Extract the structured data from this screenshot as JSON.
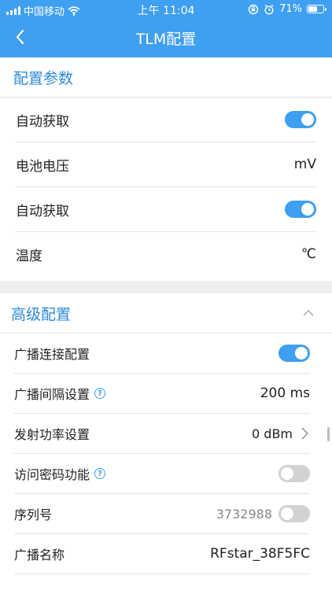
{
  "status_bar": {
    "carrier": "中国移动",
    "time": "上午 11:04",
    "battery": "71%",
    "battery_level": 0.71
  },
  "nav": {
    "title": "TLM配置"
  },
  "config": {
    "header": "配置参数",
    "rows": [
      {
        "label": "自动获取",
        "type": "toggle",
        "on": true
      },
      {
        "label": "电池电压",
        "value": "mV"
      },
      {
        "label": "自动获取",
        "type": "toggle",
        "on": true
      },
      {
        "label": "温度",
        "value": "℃"
      }
    ]
  },
  "advanced": {
    "header": "高级配置",
    "rows": [
      {
        "label": "广播连接配置",
        "type": "toggle",
        "on": true
      },
      {
        "label": "广播间隔设置",
        "help": true,
        "value": "200 ms"
      },
      {
        "label": "发射功率设置",
        "value": "0 dBm",
        "chevron": true
      },
      {
        "label": "访问密码功能",
        "help": true,
        "type": "toggle",
        "on": false
      },
      {
        "label": "序列号",
        "value": "3732988",
        "type": "toggle",
        "on": false
      },
      {
        "label": "广播名称",
        "value": "RFstar_38F5FC"
      }
    ]
  },
  "icons": {
    "help": "?"
  }
}
